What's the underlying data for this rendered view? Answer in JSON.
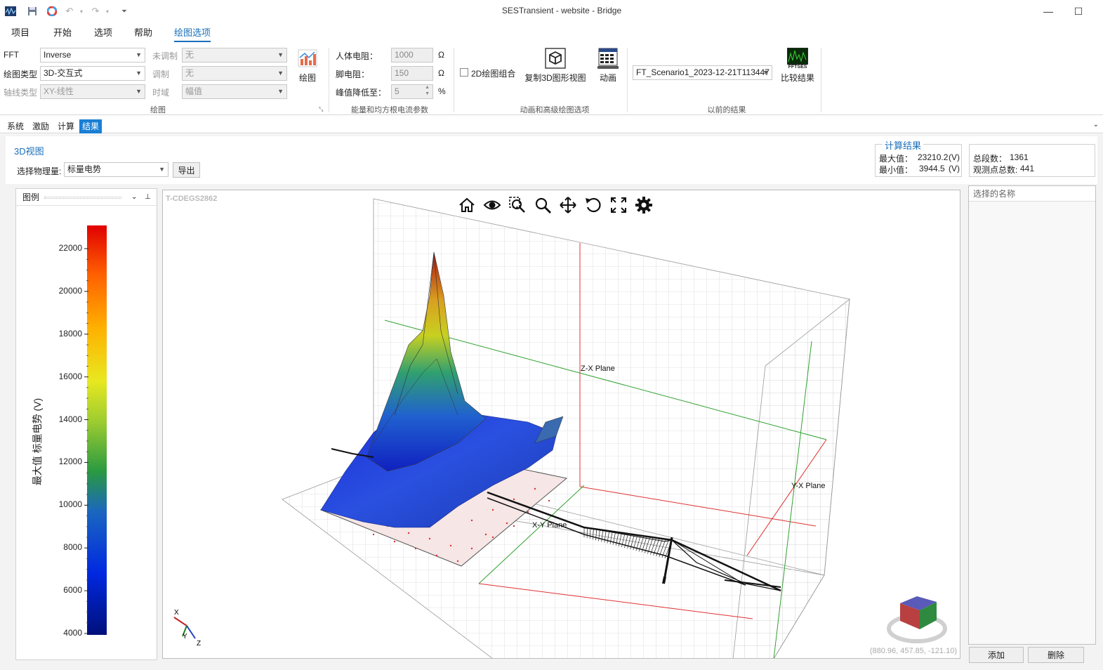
{
  "window": {
    "title": "SESTransient - website - Bridge",
    "minimize": "—",
    "maximize": "☐"
  },
  "menu": [
    "项目",
    "开始",
    "选项",
    "帮助",
    "绘图选项"
  ],
  "ribbon": {
    "fft_label": "FFT",
    "fft_value": "Inverse",
    "plot_type_label": "绘图类型",
    "plot_type_value": "3D-交互式",
    "axis_type_label": "轴线类型",
    "axis_type_value": "XY-线性",
    "unmod_label": "未调制",
    "unmod_value": "无",
    "mod_label": "调制",
    "mod_value": "无",
    "time_label": "时域",
    "time_value": "幅值",
    "plot_button": "绘图",
    "group_plot": "绘图",
    "body_res_label": "人体电阻：",
    "body_res_value": "1000",
    "body_res_unit": "Ω",
    "foot_res_label": "脚电阻：",
    "foot_res_value": "150",
    "foot_res_unit": "Ω",
    "peak_label": "峰值降低至：",
    "peak_value": "5",
    "peak_unit": "%",
    "group_energy": "能量和均方根电流参数",
    "combo2d_label": "2D绘图组合",
    "copy3d_label": "复制3D图形视图",
    "anim_label": "动画",
    "group_anim": "动画和高级绘图选项",
    "prev_result_value": "FT_Scenario1_2023-12-21T113447",
    "compare_label": "比较结果",
    "compare_icon_text": "FFTSES",
    "group_prev": "以前的结果"
  },
  "tabs": [
    "系统",
    "激励",
    "计算",
    "结果"
  ],
  "content": {
    "section_title": "3D视图",
    "select_label": "选择物理量:",
    "select_value": "标量电势",
    "export_button": "导出",
    "calc_title": "计算结果",
    "max_label": "最大值：",
    "max_value": "23210.2",
    "max_unit": "(V)",
    "min_label": "最小值：",
    "min_value": "3944.5",
    "min_unit": "(V)",
    "segments_label": "总段数：",
    "segments_value": "1361",
    "points_label": "观测点总数:",
    "points_value": "441"
  },
  "legend": {
    "header": "图例",
    "axis_title": "最大值 标量电势 (V)",
    "ticks": [
      "22000",
      "20000",
      "18000",
      "16000",
      "14000",
      "12000",
      "10000",
      "8000",
      "6000",
      "4000"
    ]
  },
  "view3d": {
    "watermark": "T-CDEGS2862",
    "zx_plane": "Z-X Plane",
    "yx_plane": "Y-X Plane",
    "xy_plane": "X-Y Plane",
    "coords": "(880.96, 457.85, -121.10)",
    "axis_x": "X",
    "axis_y": "Y",
    "axis_z": "Z"
  },
  "right_panel": {
    "header": "选择的名称",
    "add_button": "添加",
    "delete_button": "删除"
  },
  "colors": {
    "accent": "#1a7fd4",
    "menu_active": "#1a6fb8"
  }
}
